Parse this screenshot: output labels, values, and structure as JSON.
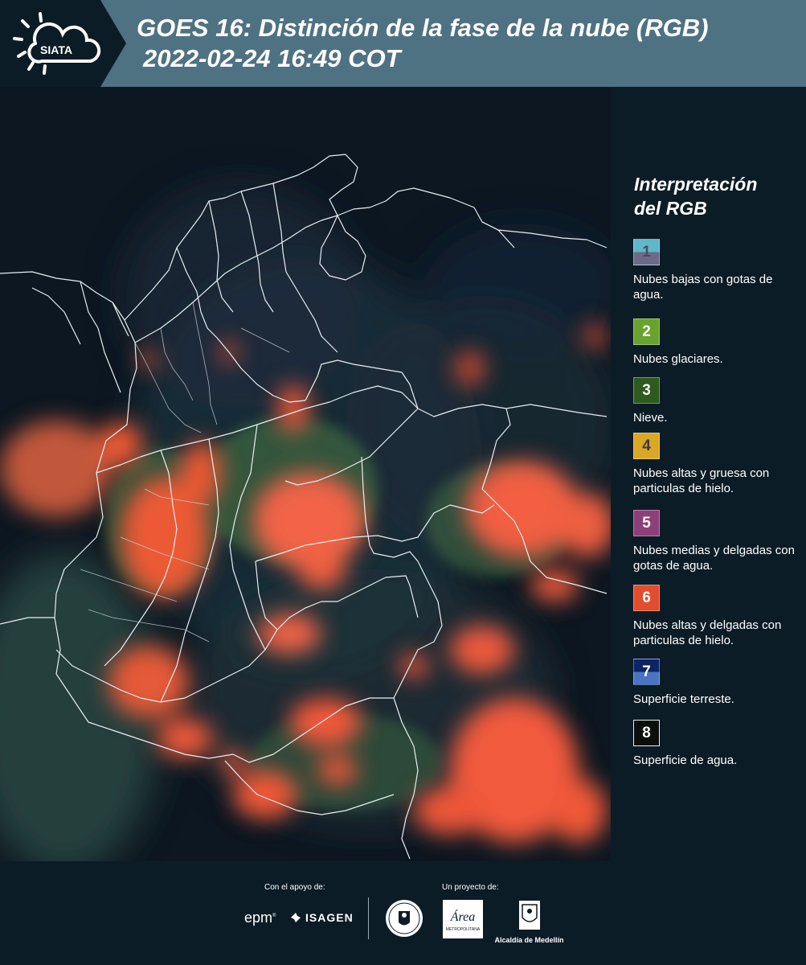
{
  "header": {
    "brand": "SIATA",
    "title_line1": "GOES 16: Distinción de la fase de la nube (RGB)",
    "title_line2": "2022-02-24 16:49 COT"
  },
  "legend": {
    "title_line1": "Interpretación",
    "title_line2": "del RGB",
    "items": [
      {
        "number": "1",
        "label": "Nubes bajas con gotas de agua.",
        "color_top": "#5fb7c7",
        "color_bottom": "#6d6a85"
      },
      {
        "number": "2",
        "label": "Nubes glaciares.",
        "color": "#69a22d"
      },
      {
        "number": "3",
        "label": "Nieve.",
        "color": "#2f5a1e"
      },
      {
        "number": "4",
        "label": "Nubes altas y gruesa con particulas de hielo.",
        "color": "#d9a825"
      },
      {
        "number": "5",
        "label": "Nubes medias y delgadas con gotas de agua.",
        "color": "#8d3f78"
      },
      {
        "number": "6",
        "label": "Nubes altas y delgadas con particulas de hielo.",
        "color": "#e24d2f"
      },
      {
        "number": "7",
        "label": "Superficie terreste.",
        "color_top": "#0d2466",
        "color_bottom": "#4a74c3"
      },
      {
        "number": "8",
        "label": "Superficie de agua.",
        "color": "#0b0f0b"
      }
    ]
  },
  "footer": {
    "support_label": "Con el apoyo de:",
    "project_label": "Un proyecto de:",
    "sponsor_1": "epm",
    "sponsor_2": "ISAGEN",
    "partner_amva": "Área",
    "partner_amva_sub": "METROPOLITANA",
    "partner_medellin": "Alcaldía de Medellín"
  }
}
